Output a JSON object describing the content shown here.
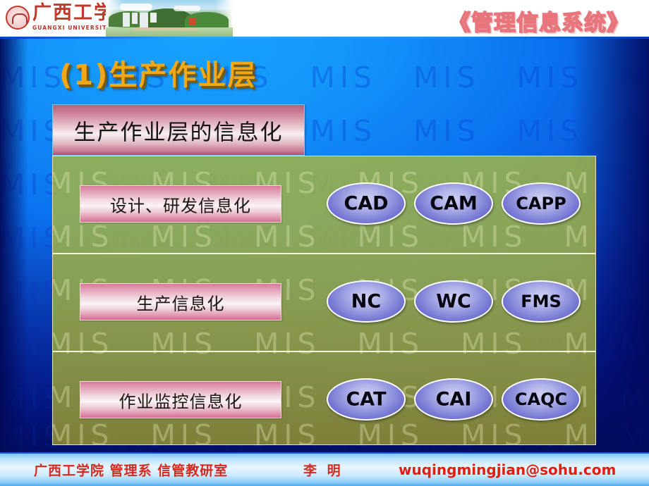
{
  "header": {
    "logo_cn": "广西工学院",
    "logo_en": "GUANGXI UNIVERSITY OF TECHNOLOGY",
    "course_title": "《管理信息系统》"
  },
  "slide": {
    "heading": "(1)生产作业层",
    "title_box": "生产作业层的信息化",
    "watermark": "MIS",
    "rows": [
      {
        "label": "设计、研发信息化",
        "badges": [
          "CAD",
          "CAM",
          "CAPP"
        ]
      },
      {
        "label": "生产信息化",
        "badges": [
          "NC",
          "WC",
          "FMS"
        ]
      },
      {
        "label": "作业监控信息化",
        "badges": [
          "CAT",
          "CAI",
          "CAQC"
        ]
      }
    ]
  },
  "footer": {
    "institution": "广西工学院  管理系  信管教研室",
    "author": "李 明",
    "email": "wuqingmingjian@sohu.com"
  },
  "colors": {
    "background_bright": "#18a2ff",
    "background_dark": "#04136f",
    "heading_gold": "#f0a818",
    "panel_olive": "#9eb046",
    "badge_violet": "#6d6fd0",
    "label_pink": "#d8799c",
    "footer_red": "#d42a20"
  }
}
